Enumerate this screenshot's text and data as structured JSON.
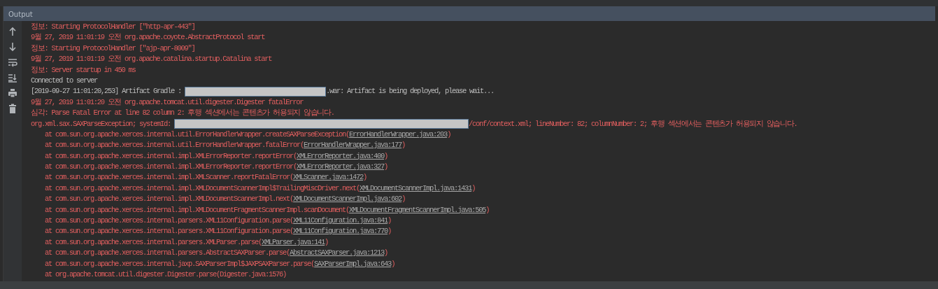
{
  "panel": {
    "title": "Output"
  },
  "toolbar": [
    {
      "kind": "up"
    },
    {
      "kind": "down"
    },
    {
      "kind": "wrap"
    },
    {
      "kind": "scroll-end"
    },
    {
      "kind": "print"
    },
    {
      "kind": "trash"
    }
  ],
  "lines": [
    {
      "kind": "error",
      "segments": [
        {
          "kind": "text",
          "text": "정보: Starting ProtocolHandler [\"http-apr-443\"]"
        }
      ]
    },
    {
      "kind": "error",
      "segments": [
        {
          "kind": "text",
          "text": "9월 27, 2019 11:01:19 오전 org.apache.coyote.AbstractProtocol start"
        }
      ]
    },
    {
      "kind": "error",
      "segments": [
        {
          "kind": "text",
          "text": "정보: Starting ProtocolHandler [\"ajp-apr-8009\"]"
        }
      ]
    },
    {
      "kind": "error",
      "segments": [
        {
          "kind": "text",
          "text": "9월 27, 2019 11:01:19 오전 org.apache.catalina.startup.Catalina start"
        }
      ]
    },
    {
      "kind": "error",
      "segments": [
        {
          "kind": "text",
          "text": "정보: Server startup in 450 ms"
        }
      ]
    },
    {
      "kind": "plain",
      "segments": [
        {
          "kind": "text",
          "text": "Connected to server"
        }
      ]
    },
    {
      "kind": "plain",
      "segments": [
        {
          "kind": "text",
          "text": "[2019-09-27 11:01:20,253] Artifact Gradle : "
        },
        {
          "kind": "redacted"
        },
        {
          "kind": "text",
          "text": ".war: Artifact is being deployed, please wait..."
        }
      ]
    },
    {
      "kind": "error",
      "segments": [
        {
          "kind": "text",
          "text": "9월 27, 2019 11:01:20 오전 org.apache.tomcat.util.digester.Digester fatalError"
        }
      ]
    },
    {
      "kind": "error",
      "segments": [
        {
          "kind": "text",
          "text": "심각: Parse Fatal Error at line 82 column 2: 후행 섹션에서는 콘텐츠가 허용되지 않습니다."
        }
      ]
    },
    {
      "kind": "error",
      "segments": [
        {
          "kind": "text",
          "text": "org.xml.sax.SAXParseException; systemId: "
        },
        {
          "kind": "redacted"
        },
        {
          "kind": "text",
          "text": "/conf/context.xml; lineNumber: 82; columnNumber: 2; 후행 섹션에서는 콘텐츠가 허용되지 않습니다."
        }
      ]
    },
    {
      "kind": "trace",
      "segments": [
        {
          "kind": "text",
          "text": "at com.sun.org.apache.xerces.internal.util.ErrorHandlerWrapper.createSAXParseException("
        },
        {
          "kind": "link",
          "text": "ErrorHandlerWrapper.java:203"
        },
        {
          "kind": "text",
          "text": ")"
        }
      ]
    },
    {
      "kind": "trace",
      "segments": [
        {
          "kind": "text",
          "text": "at com.sun.org.apache.xerces.internal.util.ErrorHandlerWrapper.fatalError("
        },
        {
          "kind": "link",
          "text": "ErrorHandlerWrapper.java:177"
        },
        {
          "kind": "text",
          "text": ")"
        }
      ]
    },
    {
      "kind": "trace",
      "segments": [
        {
          "kind": "text",
          "text": "at com.sun.org.apache.xerces.internal.impl.XMLErrorReporter.reportError("
        },
        {
          "kind": "link",
          "text": "XMLErrorReporter.java:400"
        },
        {
          "kind": "text",
          "text": ")"
        }
      ]
    },
    {
      "kind": "trace",
      "segments": [
        {
          "kind": "text",
          "text": "at com.sun.org.apache.xerces.internal.impl.XMLErrorReporter.reportError("
        },
        {
          "kind": "link",
          "text": "XMLErrorReporter.java:327"
        },
        {
          "kind": "text",
          "text": ")"
        }
      ]
    },
    {
      "kind": "trace",
      "segments": [
        {
          "kind": "text",
          "text": "at com.sun.org.apache.xerces.internal.impl.XMLScanner.reportFatalError("
        },
        {
          "kind": "link",
          "text": "XMLScanner.java:1472"
        },
        {
          "kind": "text",
          "text": ")"
        }
      ]
    },
    {
      "kind": "trace",
      "segments": [
        {
          "kind": "text",
          "text": "at com.sun.org.apache.xerces.internal.impl.XMLDocumentScannerImpl$TrailingMiscDriver.next("
        },
        {
          "kind": "link",
          "text": "XMLDocumentScannerImpl.java:1431"
        },
        {
          "kind": "text",
          "text": ")"
        }
      ]
    },
    {
      "kind": "trace",
      "segments": [
        {
          "kind": "text",
          "text": "at com.sun.org.apache.xerces.internal.impl.XMLDocumentScannerImpl.next("
        },
        {
          "kind": "link",
          "text": "XMLDocumentScannerImpl.java:602"
        },
        {
          "kind": "text",
          "text": ")"
        }
      ]
    },
    {
      "kind": "trace",
      "segments": [
        {
          "kind": "text",
          "text": "at com.sun.org.apache.xerces.internal.impl.XMLDocumentFragmentScannerImpl.scanDocument("
        },
        {
          "kind": "link",
          "text": "XMLDocumentFragmentScannerImpl.java:505"
        },
        {
          "kind": "text",
          "text": ")"
        }
      ]
    },
    {
      "kind": "trace",
      "segments": [
        {
          "kind": "text",
          "text": "at com.sun.org.apache.xerces.internal.parsers.XML11Configuration.parse("
        },
        {
          "kind": "link",
          "text": "XML11Configuration.java:841"
        },
        {
          "kind": "text",
          "text": ")"
        }
      ]
    },
    {
      "kind": "trace",
      "segments": [
        {
          "kind": "text",
          "text": "at com.sun.org.apache.xerces.internal.parsers.XML11Configuration.parse("
        },
        {
          "kind": "link",
          "text": "XML11Configuration.java:770"
        },
        {
          "kind": "text",
          "text": ")"
        }
      ]
    },
    {
      "kind": "trace",
      "segments": [
        {
          "kind": "text",
          "text": "at com.sun.org.apache.xerces.internal.parsers.XMLParser.parse("
        },
        {
          "kind": "link",
          "text": "XMLParser.java:141"
        },
        {
          "kind": "text",
          "text": ")"
        }
      ]
    },
    {
      "kind": "trace",
      "segments": [
        {
          "kind": "text",
          "text": "at com.sun.org.apache.xerces.internal.parsers.AbstractSAXParser.parse("
        },
        {
          "kind": "link",
          "text": "AbstractSAXParser.java:1213"
        },
        {
          "kind": "text",
          "text": ")"
        }
      ]
    },
    {
      "kind": "trace",
      "segments": [
        {
          "kind": "text",
          "text": "at com.sun.org.apache.xerces.internal.jaxp.SAXParserImpl$JAXPSAXParser.parse("
        },
        {
          "kind": "link",
          "text": "SAXParserImpl.java:643"
        },
        {
          "kind": "text",
          "text": ")"
        }
      ]
    },
    {
      "kind": "trace",
      "segments": [
        {
          "kind": "text",
          "text": "at org.apache.tomcat.util.digester.Digester.parse(Digester.java:1576)"
        }
      ]
    }
  ]
}
